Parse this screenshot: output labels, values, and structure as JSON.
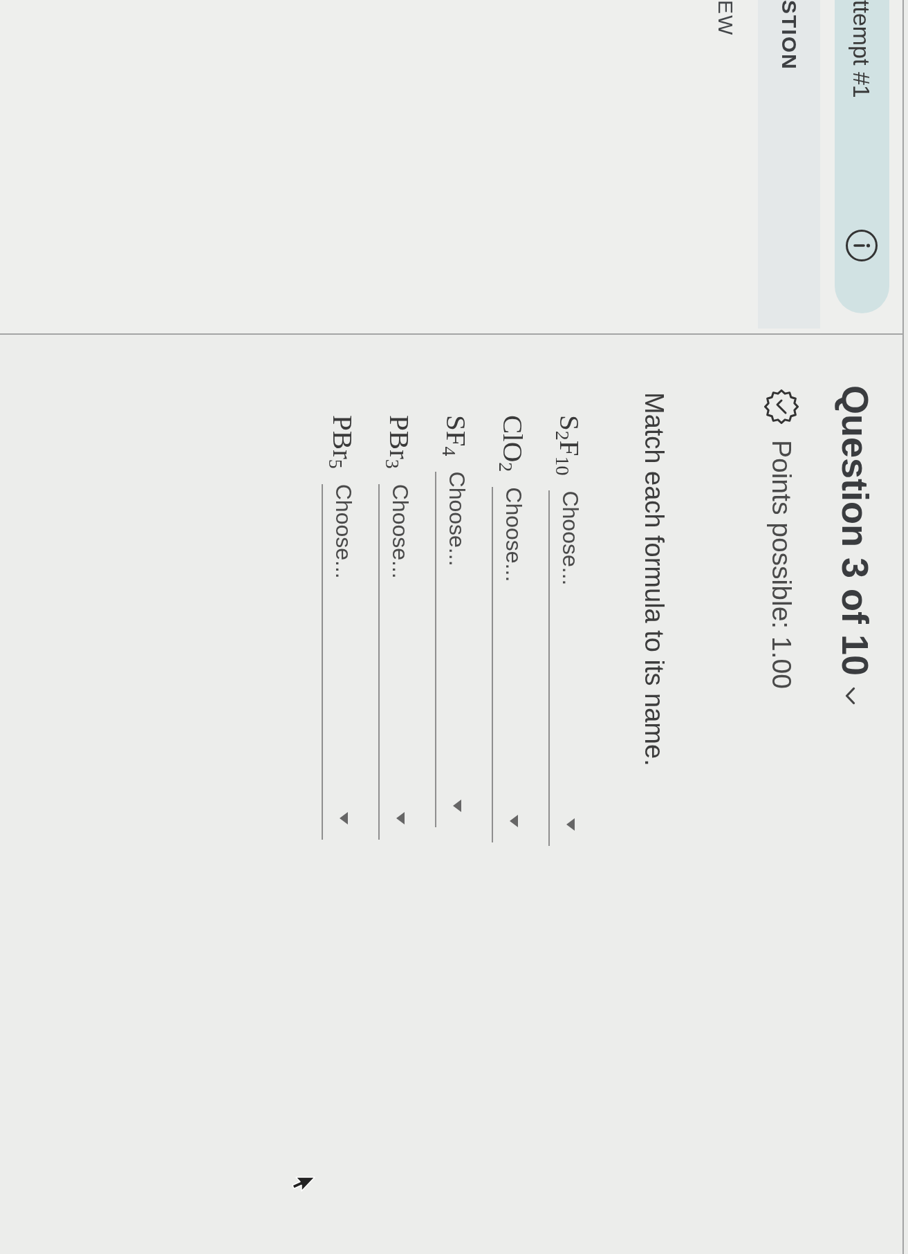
{
  "sidebar": {
    "attempt_badge": {
      "label": "ttempt #1"
    },
    "nav_items": [
      {
        "label": "STION",
        "selected": true
      },
      {
        "label": "EW",
        "selected": false
      }
    ]
  },
  "question": {
    "title": "Question 3 of 10",
    "points": "Points possible: 1.00",
    "prompt": "Match each formula to its name.",
    "matches": [
      {
        "formula": "S$_{2}$F$_{10}$",
        "placeholder": "Choose..."
      },
      {
        "formula": "ClO$_{2}$",
        "placeholder": "Choose..."
      },
      {
        "formula": "SF$_{4}$",
        "placeholder": "Choose..."
      },
      {
        "formula": "PBr$_{3}$",
        "placeholder": "Choose..."
      },
      {
        "formula": "PBr$_{5}$",
        "placeholder": "Choose..."
      }
    ]
  }
}
